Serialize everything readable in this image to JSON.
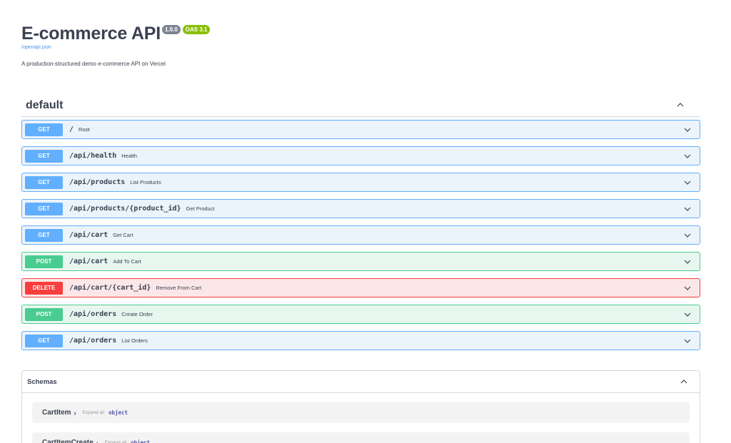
{
  "info": {
    "title": "E-commerce API",
    "version": "1.0.0",
    "oas_badge": "OAS 3.1",
    "spec_link": "/openapi.json",
    "description": "A production-structured demo e-commerce API on Vercel"
  },
  "section": {
    "title": "default"
  },
  "operations": [
    {
      "method": "GET",
      "path": "/",
      "summary": "Root"
    },
    {
      "method": "GET",
      "path": "/api/health",
      "summary": "Health"
    },
    {
      "method": "GET",
      "path": "/api/products",
      "summary": "List Products"
    },
    {
      "method": "GET",
      "path": "/api/products/{product_id}",
      "summary": "Get Product"
    },
    {
      "method": "GET",
      "path": "/api/cart",
      "summary": "Get Cart"
    },
    {
      "method": "POST",
      "path": "/api/cart",
      "summary": "Add To Cart"
    },
    {
      "method": "DELETE",
      "path": "/api/cart/{cart_id}",
      "summary": "Remove From Cart"
    },
    {
      "method": "POST",
      "path": "/api/orders",
      "summary": "Create Order"
    },
    {
      "method": "GET",
      "path": "/api/orders",
      "summary": "List Orders"
    }
  ],
  "schemas": {
    "title": "Schemas",
    "models": [
      {
        "name": "CartItem",
        "arrow": "›",
        "expand": "Expand all",
        "type": "object"
      },
      {
        "name": "CartItemCreate",
        "arrow": "›",
        "expand": "Expand all",
        "type": "object"
      }
    ]
  },
  "colors": {
    "get": "#61affe",
    "post": "#49cc90",
    "delete": "#f93e3e",
    "version_badge": "#7d8492",
    "oas_badge": "#89bf04",
    "link": "#4990e2"
  },
  "icons": {
    "collapse": "chevron-up-icon",
    "expand": "chevron-down-icon"
  }
}
